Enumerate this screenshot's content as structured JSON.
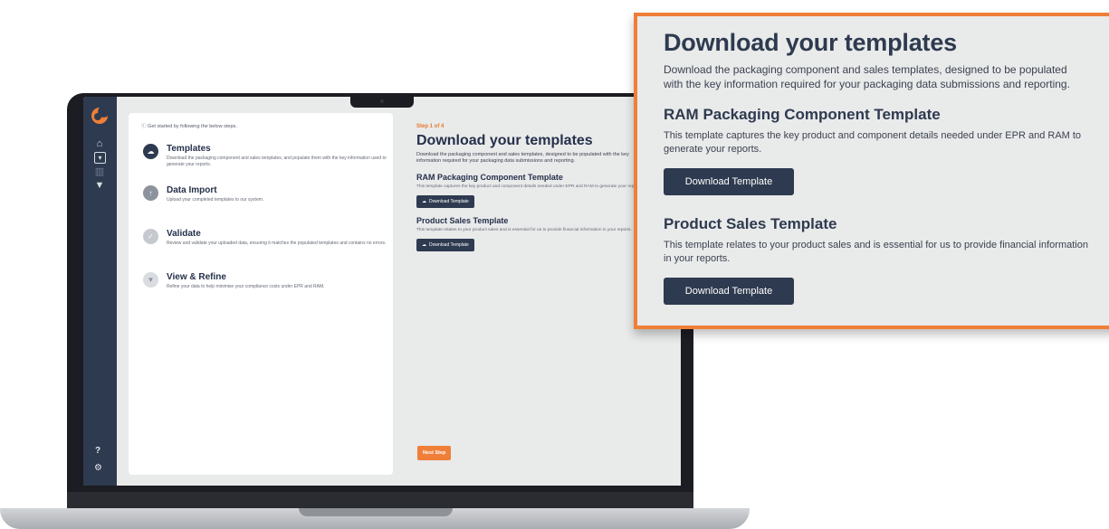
{
  "app": {
    "colors": {
      "sidebar": "#2e3a4f",
      "accent": "#ef7f38",
      "heading": "#25304a",
      "screen_bg": "#e9eaea"
    }
  },
  "steps_panel": {
    "intro": "Get started by following the below steps.",
    "steps": [
      {
        "icon": "cloud-download-icon",
        "title": "Templates",
        "description": "Download the packaging component and sales templates, and populate them with the key information used to generate your reports."
      },
      {
        "icon": "upload-icon",
        "title": "Data Import",
        "description": "Upload your completed templates to our system."
      },
      {
        "icon": "check-icon",
        "title": "Validate",
        "description": "Review and validate your uploaded data, ensuring it matches the populated templates and contains no errors."
      },
      {
        "icon": "funnel-icon",
        "title": "View & Refine",
        "description": "Refine your data to help minimise your compliance costs under EPR and RAM."
      }
    ]
  },
  "content": {
    "step_label": "Step 1 of 4",
    "title": "Download your templates",
    "intro": "Download the packaging component and sales templates, designed to be populated with the key information required for your packaging data submissions and reporting.",
    "ram_title": "RAM Packaging Component Template",
    "ram_desc": "This template captures the key product and component details needed under EPR and RAM to generate your reports.",
    "download_label": "Download Template",
    "sales_title": "Product Sales Template",
    "sales_desc": "This template relates to your product sales and is essential for us to provide financial information in your reports.",
    "next_label": "Next Step",
    "help_label": "?"
  }
}
